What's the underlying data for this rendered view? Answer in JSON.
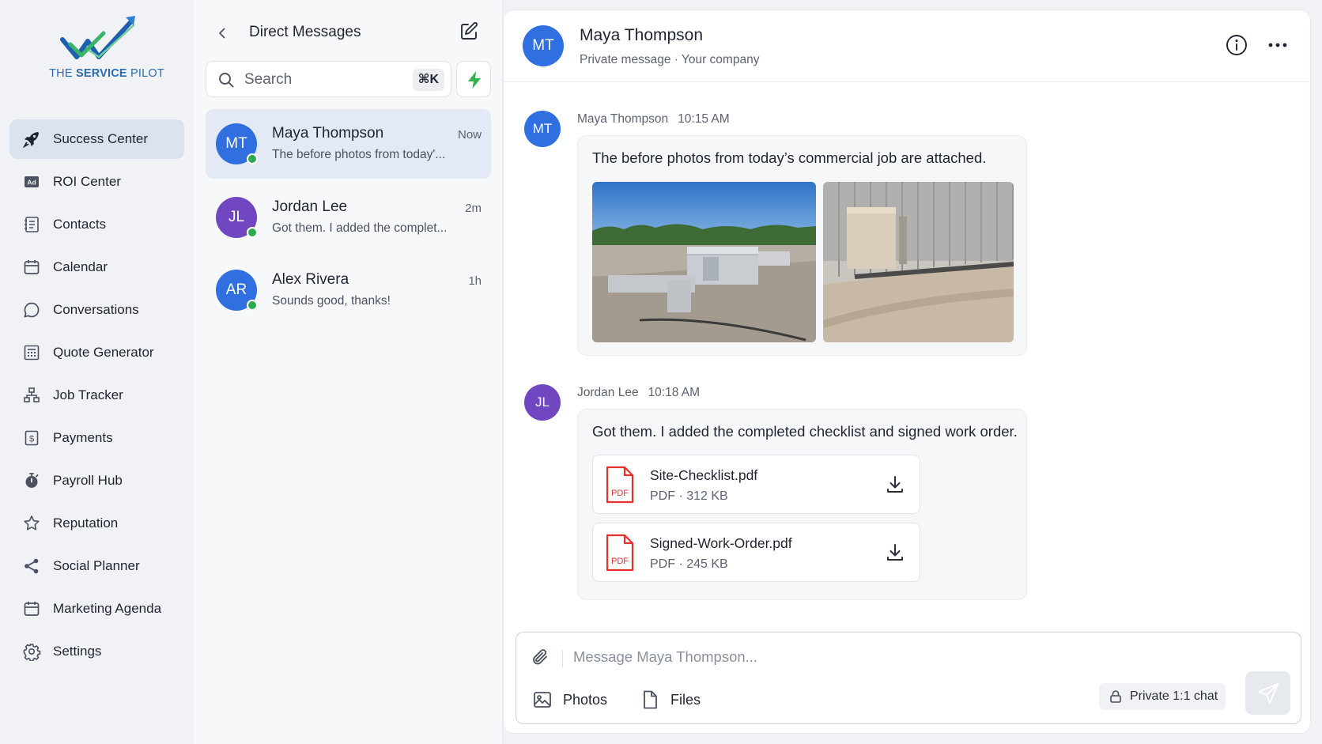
{
  "brand": {
    "name_prefix": "THE ",
    "name_bold": "SERVICE",
    "name_suffix": " PILOT"
  },
  "sidebar": {
    "items": [
      {
        "label": "Success Center",
        "icon": "rocket-icon",
        "active": true
      },
      {
        "label": "ROI Center",
        "icon": "ad-icon"
      },
      {
        "label": "Contacts",
        "icon": "contacts-icon"
      },
      {
        "label": "Calendar",
        "icon": "calendar-icon"
      },
      {
        "label": "Conversations",
        "icon": "chat-bubble-icon"
      },
      {
        "label": "Quote Generator",
        "icon": "calculator-icon"
      },
      {
        "label": "Job Tracker",
        "icon": "hierarchy-icon"
      },
      {
        "label": "Payments",
        "icon": "dollar-icon"
      },
      {
        "label": "Payroll Hub",
        "icon": "stopwatch-icon"
      },
      {
        "label": "Reputation",
        "icon": "star-icon"
      },
      {
        "label": "Social Planner",
        "icon": "share-icon"
      },
      {
        "label": "Marketing Agenda",
        "icon": "calendar-icon"
      },
      {
        "label": "Settings",
        "icon": "gear-icon"
      }
    ]
  },
  "dm": {
    "title": "Direct Messages",
    "search": {
      "placeholder": "Search",
      "shortcut": "⌘K"
    },
    "conversations": [
      {
        "initials": "MT",
        "name": "Maya Thompson",
        "time": "Now",
        "preview": "The before photos from today'...",
        "color": "#2f6fe0",
        "online": true,
        "active": true
      },
      {
        "initials": "JL",
        "name": "Jordan Lee",
        "time": "2m",
        "preview": "Got them. I added the complet...",
        "color": "#7047c0",
        "online": true
      },
      {
        "initials": "AR",
        "name": "Alex Rivera",
        "time": "1h",
        "preview": "Sounds good, thanks!",
        "color": "#2f6fe0",
        "online": true
      }
    ]
  },
  "chat": {
    "header": {
      "initials": "MT",
      "name": "Maya Thompson",
      "subtitle": "Private message · Your company"
    },
    "messages": [
      {
        "initials": "MT",
        "author": "Maya Thompson",
        "time": "10:15 AM",
        "text": "The before photos from today’s commercial job are attached.",
        "photos": [
          "rooftop-hvac-units-photo",
          "hvac-unit-by-metal-wall-photo"
        ]
      },
      {
        "initials": "JL",
        "author": "Jordan Lee",
        "time": "10:18 AM",
        "text": "Got them. I added the completed checklist and signed work order.",
        "files": [
          {
            "name": "Site-Checklist.pdf",
            "meta": "PDF · 312 KB"
          },
          {
            "name": "Signed-Work-Order.pdf",
            "meta": "PDF · 245 KB"
          }
        ]
      }
    ],
    "composer": {
      "placeholder": "Message Maya Thompson...",
      "photos_label": "Photos",
      "files_label": "Files",
      "privacy_label": "Private 1:1 chat"
    }
  },
  "colors": {
    "accent": "#2f6fe0",
    "purple": "#7047c0",
    "online": "#2faa4f",
    "pdf_red": "#e5312b",
    "bolt_green": "#34b04c"
  }
}
